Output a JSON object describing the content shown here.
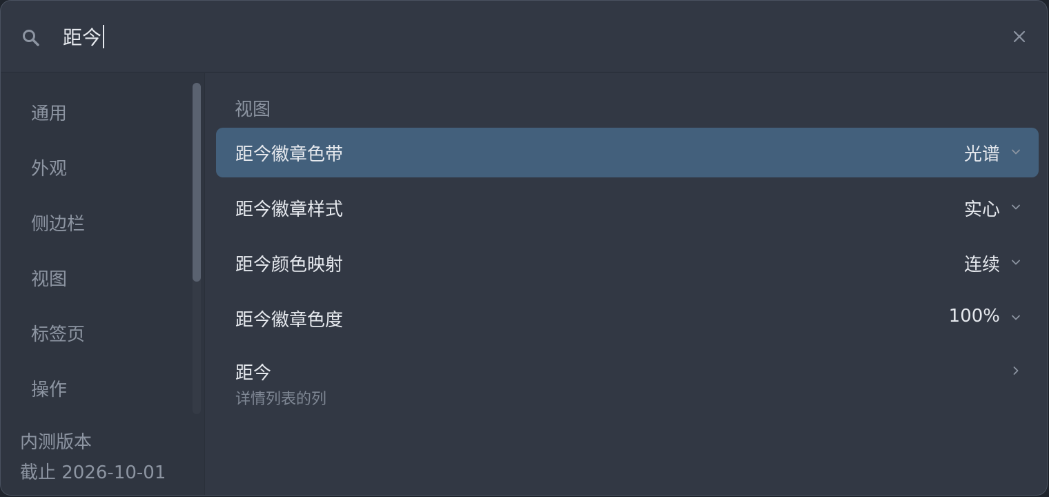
{
  "search": {
    "value": "距今",
    "placeholder": ""
  },
  "icons": {
    "search": "search-icon",
    "close": "close-icon",
    "chevron_down": "chevron-down-icon",
    "chevron_right": "chevron-right-icon"
  },
  "sidebar": {
    "items": [
      {
        "label": "通用"
      },
      {
        "label": "外观"
      },
      {
        "label": "侧边栏"
      },
      {
        "label": "视图"
      },
      {
        "label": "标签页"
      },
      {
        "label": "操作"
      }
    ],
    "footer": {
      "line1": "内测版本",
      "line2": "截止 2026-10-01"
    }
  },
  "main": {
    "section_title": "视图",
    "rows": [
      {
        "label": "距今徽章色带",
        "value": "光谱"
      },
      {
        "label": "距今徽章样式",
        "value": "实心"
      },
      {
        "label": "距今颜色映射",
        "value": "连续"
      },
      {
        "label": "距今徽章色度",
        "value": "100%"
      },
      {
        "label": "距今",
        "subtitle": "详情列表的列"
      }
    ]
  },
  "colors": {
    "window_bg": "#323844",
    "sidebar_bg": "#2f3540",
    "selected_row": "#43607c",
    "text_primary": "#e6e9ee",
    "text_muted": "#8d95a2"
  }
}
